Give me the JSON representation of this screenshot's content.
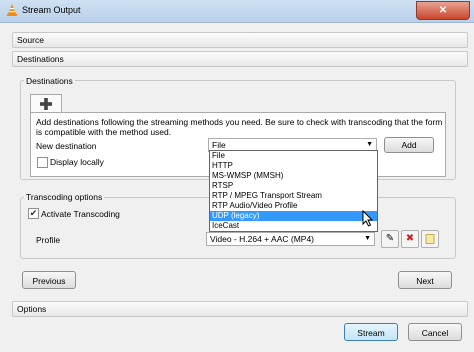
{
  "window": {
    "title": "Stream Output",
    "close_label": "✕"
  },
  "sections": {
    "source": "Source",
    "destinations": "Destinations",
    "options": "Options"
  },
  "destinations_group": {
    "title": "Destinations",
    "add_tab_icon": "plus-icon",
    "info_text_line1": "Add destinations following the streaming methods you need. Be sure to check with transcoding that the format",
    "info_text_line2": "is compatible with the method used.",
    "new_destination_label": "New destination",
    "new_destination_value": "File",
    "add_button": "Add",
    "display_locally_label": "Display locally",
    "display_locally_checked": false,
    "dropdown_options": [
      "File",
      "HTTP",
      "MS-WMSP (MMSH)",
      "RTSP",
      "RTP / MPEG Transport Stream",
      "RTP Audio/Video Profile",
      "UDP (legacy)",
      "IceCast"
    ],
    "selected_option": "UDP (legacy)"
  },
  "transcoding_group": {
    "title": "Transcoding options",
    "activate_label": "Activate Transcoding",
    "activate_checked": true,
    "profile_label": "Profile",
    "profile_value": "Video - H.264 + AAC (MP4)"
  },
  "nav": {
    "previous": "Previous",
    "next": "Next"
  },
  "footer": {
    "stream": "Stream",
    "cancel": "Cancel"
  },
  "colors": {
    "accent": "#3399ff",
    "titlebar": "#b9d1ea",
    "close": "#c9462c"
  }
}
